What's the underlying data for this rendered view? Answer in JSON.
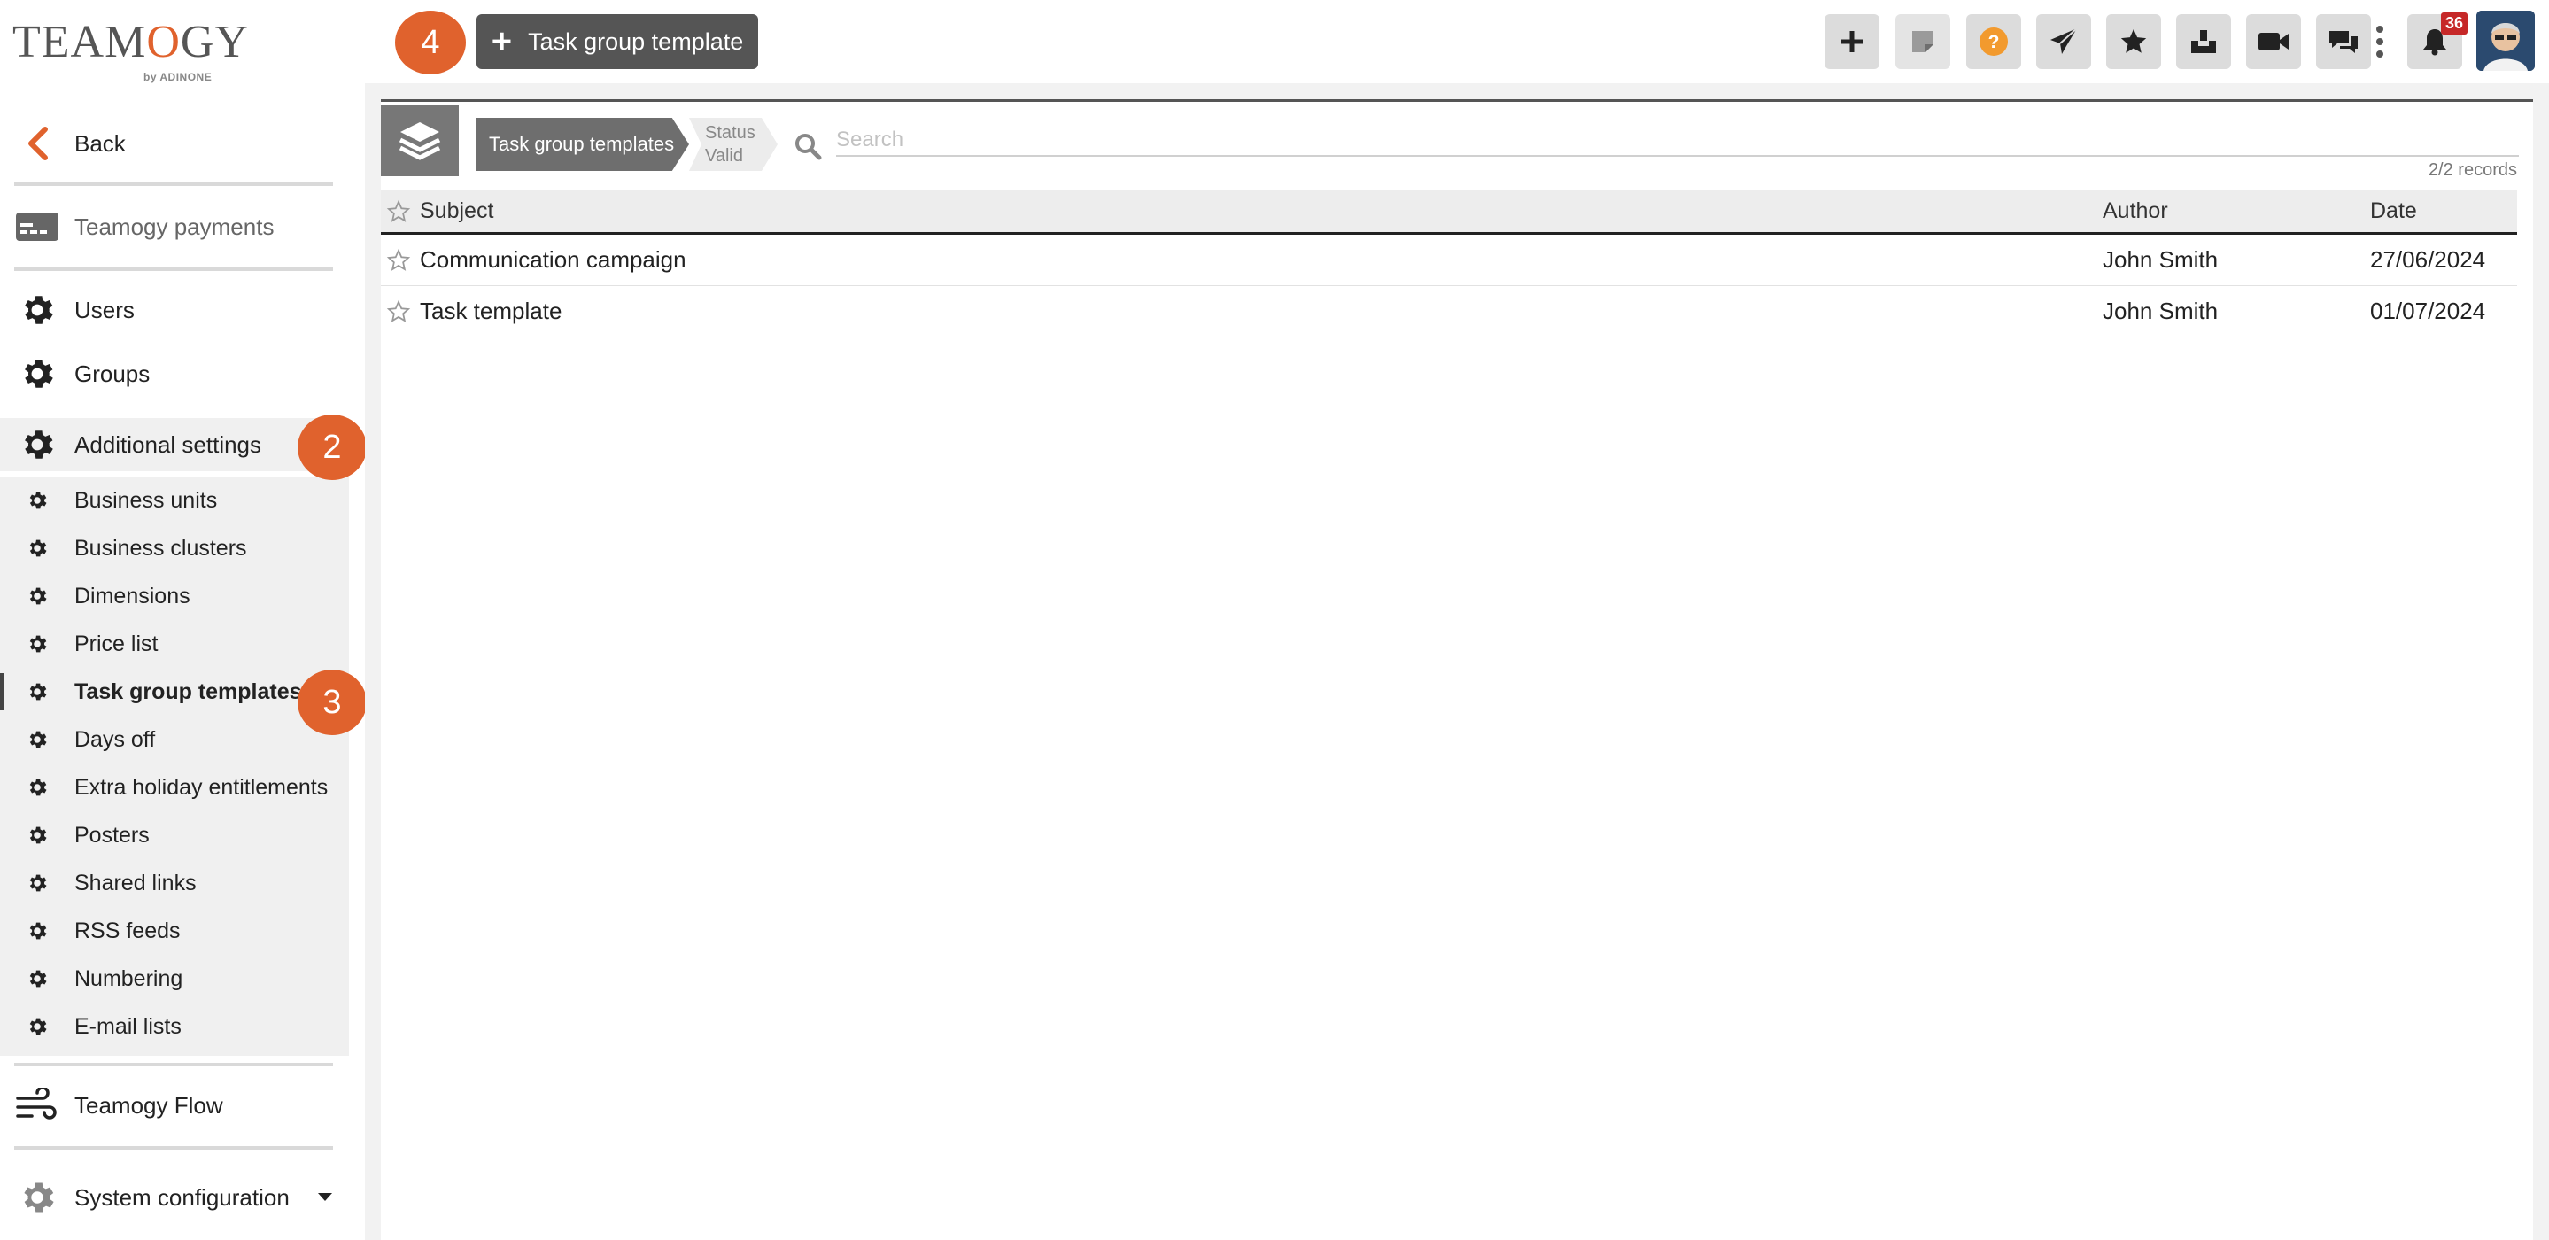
{
  "app": {
    "logo_text": "TEAMOGY",
    "logo_sub": "by ADINONE"
  },
  "topbar": {
    "new_button_label": "Task group template",
    "step_badge": "4",
    "icons": [
      "plus-icon",
      "note-icon",
      "help-icon",
      "send-icon",
      "star-icon",
      "inbox-icon",
      "video-icon",
      "chat-icon",
      "more-icon",
      "bell-icon"
    ],
    "notifications_count": "36",
    "colors": {
      "primary_button": "#555555",
      "accent": "#e0622d",
      "help": "#f29a2e",
      "notification": "#c62828"
    }
  },
  "sidebar": {
    "back_label": "Back",
    "payments_label": "Teamogy payments",
    "users_label": "Users",
    "groups_label": "Groups",
    "additional_label": "Additional settings",
    "additional_badge": "2",
    "submenu": [
      {
        "label": "Business units"
      },
      {
        "label": "Business clusters"
      },
      {
        "label": "Dimensions"
      },
      {
        "label": "Price list"
      },
      {
        "label": "Task group templates",
        "active": true
      },
      {
        "label": "Days off"
      },
      {
        "label": "Extra holiday entitlements"
      },
      {
        "label": "Posters"
      },
      {
        "label": "Shared links"
      },
      {
        "label": "RSS feeds"
      },
      {
        "label": "Numbering"
      },
      {
        "label": "E-mail lists"
      }
    ],
    "active_badge": "3",
    "flow_label": "Teamogy Flow",
    "system_label": "System configuration"
  },
  "main": {
    "breadcrumb": "Task group templates",
    "status_label": "Status",
    "status_value": "Valid",
    "search_placeholder": "Search",
    "records": "2/2 records",
    "columns": {
      "subject": "Subject",
      "author": "Author",
      "date": "Date"
    },
    "rows": [
      {
        "subject": "Communication campaign",
        "author": "John Smith",
        "date": "27/06/2024"
      },
      {
        "subject": "Task template",
        "author": "John Smith",
        "date": "01/07/2024"
      }
    ]
  }
}
